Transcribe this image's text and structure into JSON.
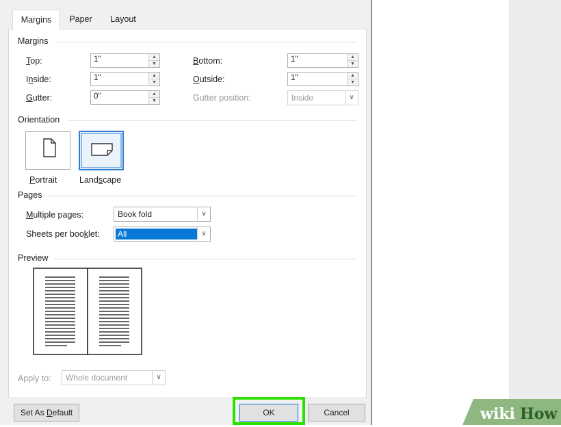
{
  "tabs": [
    {
      "label": "Margins",
      "active": true
    },
    {
      "label": "Paper",
      "active": false
    },
    {
      "label": "Layout",
      "active": false
    }
  ],
  "margins": {
    "section_title": "Margins",
    "top": {
      "label": "Top:",
      "value": "1\""
    },
    "inside": {
      "label": "Inside:",
      "value": "1\""
    },
    "gutter": {
      "label": "Gutter:",
      "value": "0\""
    },
    "bottom": {
      "label": "Bottom:",
      "value": "1\""
    },
    "outside": {
      "label": "Outside:",
      "value": "1\""
    },
    "gutter_position": {
      "label": "Gutter position:",
      "value": "Inside"
    }
  },
  "orientation": {
    "section_title": "Orientation",
    "portrait": "Portrait",
    "landscape": "Landscape",
    "selected": "landscape"
  },
  "pages": {
    "section_title": "Pages",
    "multiple_pages": {
      "label": "Multiple pages:",
      "value": "Book fold"
    },
    "sheets_per_booklet": {
      "label": "Sheets per booklet:",
      "value": "All"
    }
  },
  "preview": {
    "section_title": "Preview",
    "apply_to": {
      "label": "Apply to:",
      "value": "Whole document"
    }
  },
  "buttons": {
    "set_default": "Set As Default",
    "ok": "OK",
    "cancel": "Cancel"
  },
  "watermark": {
    "text_left": "wiki",
    "text_right": "How"
  },
  "colors": {
    "ok_highlight": "#2de000",
    "selection_blue": "#0a78d7",
    "orientation_selected": "#2f7fd6"
  }
}
